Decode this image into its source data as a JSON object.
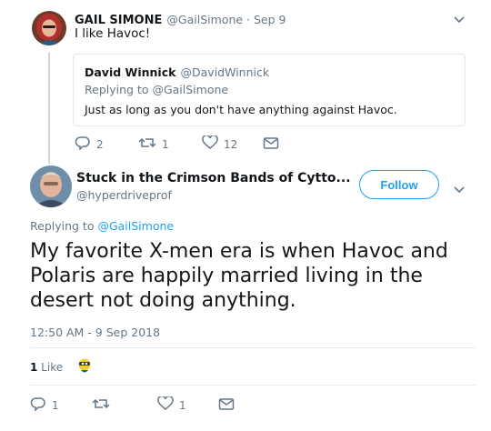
{
  "parent_tweet": {
    "author_name": "GAIL SIMONE",
    "author_handle": "@GailSimone",
    "separator": " · ",
    "date": "Sep 9",
    "text": "I like Havoc!",
    "quoted": {
      "author_name": "David Winnick",
      "author_handle": "@DavidWinnick",
      "replying_prefix": "Replying to ",
      "replying_handle": "@GailSimone",
      "text": "Just as long as you don't have anything against Havoc."
    },
    "actions": {
      "replies": "2",
      "retweets": "1",
      "likes": "12"
    }
  },
  "main_tweet": {
    "author_name": "Stuck in the Crimson Bands of Cytto...",
    "author_handle": "@hyperdriveprof",
    "follow_label": "Follow",
    "replying_prefix": "Replying to ",
    "replying_handle": "@GailSimone",
    "text": "My favorite X-men era is when Havoc and Polaris are happily married living in the desert not doing anything.",
    "timestamp": "12:50 AM - 9 Sep 2018",
    "like_count": "1",
    "like_label": " Like",
    "actions": {
      "replies": "1",
      "retweets": "",
      "likes": "1"
    }
  },
  "icons": {
    "reply": "reply-icon",
    "retweet": "retweet-icon",
    "like": "heart-icon",
    "dm": "envelope-icon",
    "more": "chevron-down-icon"
  },
  "colors": {
    "accent": "#1da1f2",
    "muted": "#657786",
    "text": "#14171a",
    "border": "#e1e8ed"
  }
}
